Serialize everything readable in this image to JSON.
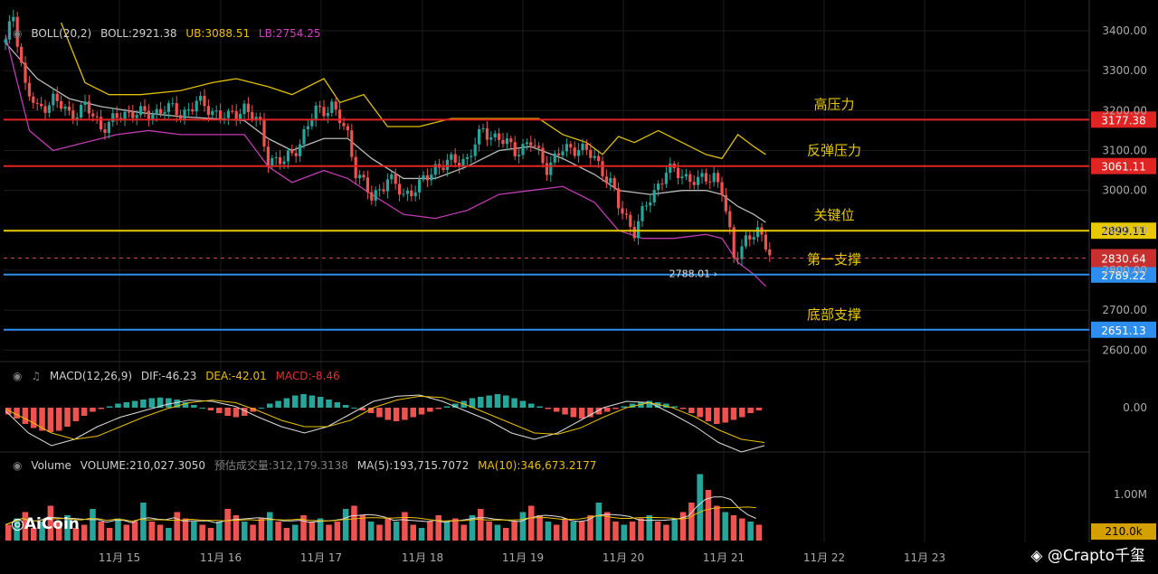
{
  "boll_header": {
    "name": "BOLL(20,2)",
    "boll": "BOLL:2921.38",
    "ub": "UB:3088.51",
    "lb": "LB:2754.25"
  },
  "macd_header": {
    "name": "MACD(12,26,9)",
    "dif": "DIF:-46.23",
    "dea": "DEA:-42.01",
    "macd": "MACD:-8.46"
  },
  "vol_header": {
    "name": "Volume",
    "volume": "VOLUME:210,027.3050",
    "est": "预估成交量:312,179.3138",
    "ma5": "MA(5):193,715.7072",
    "ma10": "MA(10):346,673.2177"
  },
  "logo": "AiCoin",
  "watermark": "@Crapto千玺",
  "colors": {
    "up": "#26a69a",
    "down": "#ef5350",
    "red_line": "#e02424",
    "yellow_line": "#e8c800",
    "blue_line": "#2d8ef0",
    "mid": "#bbbbbb",
    "band_upper": "#e0c000",
    "band_lower": "#c03cb0"
  },
  "chart_data": [
    {
      "type": "line",
      "title": "",
      "y_ticks": [
        3400,
        3300,
        3200,
        3100,
        3000,
        2900,
        2800,
        2700,
        2600
      ],
      "y_tick_labels": [
        "3400.00",
        "3300.00",
        "3200.00",
        "3100.00",
        "3000.00",
        "2900.00",
        "2800.00",
        "2700.00",
        "2600.00"
      ],
      "ylim": [
        2570,
        3440
      ],
      "x_tick_labels": [
        "11月 15",
        "11月 16",
        "11月 17",
        "11月 18",
        "11月 19",
        "11月 20",
        "11月 21",
        "11月 22",
        "11月 23"
      ],
      "levels": [
        {
          "value": 3177.38,
          "label": "3177.38",
          "annotation": "高压力",
          "color": "red"
        },
        {
          "value": 3061.11,
          "label": "3061.11",
          "annotation": "反弹压力",
          "color": "red"
        },
        {
          "value": 2899.11,
          "label": "2899.11",
          "annotation": "关键位",
          "color": "yellow"
        },
        {
          "value": 2789.22,
          "label": "2789.22",
          "annotation": "第一支撑",
          "color": "blue"
        },
        {
          "value": 2651.13,
          "label": "2651.13",
          "annotation": "底部支撑",
          "color": "blue"
        }
      ],
      "current_price": {
        "value": 2830.64,
        "label": "2830.64"
      },
      "low_marker": {
        "value": 2788.01,
        "label": "2788.01"
      },
      "price_path": [
        [
          0,
          3370
        ],
        [
          2,
          3440
        ],
        [
          5,
          3260
        ],
        [
          8,
          3200
        ],
        [
          12,
          3230
        ],
        [
          16,
          3190
        ],
        [
          20,
          3210
        ],
        [
          24,
          3160
        ],
        [
          28,
          3180
        ],
        [
          32,
          3200
        ],
        [
          36,
          3185
        ],
        [
          40,
          3210
        ],
        [
          44,
          3190
        ],
        [
          48,
          3220
        ],
        [
          52,
          3200
        ],
        [
          56,
          3180
        ],
        [
          60,
          3210
        ],
        [
          64,
          3160
        ],
        [
          66,
          3080
        ],
        [
          70,
          3070
        ],
        [
          74,
          3120
        ],
        [
          78,
          3200
        ],
        [
          82,
          3210
        ],
        [
          86,
          3140
        ],
        [
          88,
          3050
        ],
        [
          92,
          2980
        ],
        [
          96,
          3030
        ],
        [
          100,
          2990
        ],
        [
          104,
          3010
        ],
        [
          108,
          3060
        ],
        [
          112,
          3070
        ],
        [
          116,
          3080
        ],
        [
          120,
          3150
        ],
        [
          124,
          3130
        ],
        [
          128,
          3100
        ],
        [
          132,
          3120
        ],
        [
          136,
          3060
        ],
        [
          140,
          3100
        ],
        [
          144,
          3110
        ],
        [
          148,
          3080
        ],
        [
          152,
          3020
        ],
        [
          154,
          2960
        ],
        [
          158,
          2900
        ],
        [
          162,
          2980
        ],
        [
          166,
          3050
        ],
        [
          170,
          3040
        ],
        [
          174,
          3020
        ],
        [
          178,
          3040
        ],
        [
          180,
          3000
        ],
        [
          183,
          2830
        ],
        [
          186,
          2880
        ],
        [
          189,
          2890
        ],
        [
          191,
          2870
        ],
        [
          193,
          2830
        ]
      ],
      "series_upper": [
        [
          14,
          3420
        ],
        [
          20,
          3270
        ],
        [
          26,
          3240
        ],
        [
          34,
          3240
        ],
        [
          44,
          3250
        ],
        [
          52,
          3270
        ],
        [
          58,
          3280
        ],
        [
          66,
          3260
        ],
        [
          72,
          3240
        ],
        [
          80,
          3280
        ],
        [
          84,
          3220
        ],
        [
          90,
          3240
        ],
        [
          96,
          3160
        ],
        [
          104,
          3160
        ],
        [
          112,
          3180
        ],
        [
          120,
          3180
        ],
        [
          128,
          3180
        ],
        [
          134,
          3180
        ],
        [
          140,
          3140
        ],
        [
          146,
          3120
        ],
        [
          150,
          3090
        ],
        [
          154,
          3135
        ],
        [
          158,
          3120
        ],
        [
          164,
          3150
        ],
        [
          170,
          3120
        ],
        [
          176,
          3090
        ],
        [
          180,
          3080
        ],
        [
          184,
          3140
        ],
        [
          188,
          3110
        ],
        [
          191,
          3090
        ]
      ],
      "series_mid": [
        [
          0,
          3370
        ],
        [
          8,
          3280
        ],
        [
          16,
          3230
        ],
        [
          24,
          3210
        ],
        [
          34,
          3195
        ],
        [
          44,
          3185
        ],
        [
          52,
          3180
        ],
        [
          60,
          3175
        ],
        [
          66,
          3130
        ],
        [
          72,
          3100
        ],
        [
          80,
          3130
        ],
        [
          86,
          3130
        ],
        [
          92,
          3080
        ],
        [
          100,
          3030
        ],
        [
          108,
          3030
        ],
        [
          116,
          3060
        ],
        [
          124,
          3100
        ],
        [
          132,
          3110
        ],
        [
          140,
          3080
        ],
        [
          148,
          3040
        ],
        [
          154,
          3000
        ],
        [
          162,
          2990
        ],
        [
          170,
          3000
        ],
        [
          176,
          3000
        ],
        [
          180,
          2990
        ],
        [
          184,
          2960
        ],
        [
          188,
          2940
        ],
        [
          191,
          2920
        ]
      ],
      "series_lower": [
        [
          0,
          3390
        ],
        [
          6,
          3150
        ],
        [
          12,
          3100
        ],
        [
          20,
          3120
        ],
        [
          28,
          3140
        ],
        [
          36,
          3150
        ],
        [
          44,
          3140
        ],
        [
          52,
          3140
        ],
        [
          60,
          3140
        ],
        [
          66,
          3060
        ],
        [
          72,
          3020
        ],
        [
          80,
          3050
        ],
        [
          86,
          3030
        ],
        [
          92,
          2990
        ],
        [
          100,
          2940
        ],
        [
          108,
          2930
        ],
        [
          116,
          2950
        ],
        [
          124,
          2990
        ],
        [
          132,
          3000
        ],
        [
          140,
          3010
        ],
        [
          148,
          2970
        ],
        [
          154,
          2900
        ],
        [
          160,
          2880
        ],
        [
          168,
          2880
        ],
        [
          176,
          2890
        ],
        [
          180,
          2880
        ],
        [
          184,
          2820
        ],
        [
          188,
          2790
        ],
        [
          191,
          2760
        ]
      ]
    },
    {
      "type": "bar",
      "title": "MACD",
      "y_ticks": [
        0
      ],
      "y_tick_labels": [
        "0.00"
      ],
      "histogram": [
        -10,
        -16,
        -24,
        -30,
        -34,
        -36,
        -34,
        -28,
        -20,
        -12,
        -6,
        -2,
        2,
        6,
        8,
        10,
        12,
        14,
        15,
        14,
        12,
        8,
        4,
        0,
        -4,
        -8,
        -12,
        -14,
        -12,
        -6,
        0,
        6,
        10,
        14,
        18,
        20,
        18,
        16,
        12,
        8,
        4,
        0,
        -4,
        -8,
        -14,
        -18,
        -20,
        -18,
        -14,
        -10,
        -6,
        -2,
        2,
        6,
        10,
        14,
        16,
        18,
        20,
        18,
        14,
        10,
        6,
        2,
        -2,
        -6,
        -10,
        -14,
        -16,
        -14,
        -10,
        -6,
        -2,
        2,
        6,
        8,
        10,
        8,
        6,
        2,
        -2,
        -8,
        -14,
        -20,
        -24,
        -22,
        -18,
        -14,
        -8,
        -4
      ],
      "dif": [
        -5,
        -40,
        -60,
        -50,
        -30,
        -15,
        -5,
        5,
        12,
        10,
        2,
        -15,
        -30,
        -40,
        -30,
        -10,
        10,
        18,
        20,
        10,
        -5,
        -20,
        -40,
        -50,
        -40,
        -20,
        0,
        10,
        8,
        -10,
        -30,
        -55,
        -70,
        -60
      ],
      "dea": [
        -2,
        -20,
        -40,
        -50,
        -45,
        -30,
        -15,
        -2,
        8,
        12,
        8,
        -5,
        -20,
        -30,
        -30,
        -20,
        0,
        12,
        18,
        16,
        5,
        -10,
        -25,
        -40,
        -42,
        -32,
        -15,
        0,
        8,
        0,
        -15,
        -35,
        -50,
        -55
      ]
    },
    {
      "type": "bar",
      "title": "Volume",
      "y_ticks": [
        1000000,
        210000
      ],
      "y_tick_labels": [
        "1.00M",
        "210.0k"
      ],
      "values": [
        0.25,
        0.35,
        0.45,
        0.2,
        0.3,
        0.55,
        0.3,
        0.4,
        0.2,
        0.25,
        0.5,
        0.3,
        0.2,
        0.35,
        0.25,
        0.3,
        0.6,
        0.3,
        0.25,
        0.2,
        0.45,
        0.35,
        0.3,
        0.25,
        0.2,
        0.3,
        0.5,
        0.4,
        0.3,
        0.25,
        0.35,
        0.45,
        0.3,
        0.2,
        0.25,
        0.4,
        0.3,
        0.35,
        0.25,
        0.3,
        0.5,
        0.55,
        0.4,
        0.3,
        0.25,
        0.35,
        0.3,
        0.45,
        0.25,
        0.2,
        0.3,
        0.4,
        0.3,
        0.35,
        0.25,
        0.4,
        0.5,
        0.3,
        0.25,
        0.2,
        0.3,
        0.45,
        0.55,
        0.4,
        0.3,
        0.25,
        0.35,
        0.3,
        0.3,
        0.4,
        0.6,
        0.45,
        0.3,
        0.25,
        0.3,
        0.35,
        0.4,
        0.3,
        0.25,
        0.35,
        0.45,
        0.6,
        1.05,
        0.8,
        0.55,
        0.45,
        0.4,
        0.35,
        0.3,
        0.25
      ]
    }
  ]
}
